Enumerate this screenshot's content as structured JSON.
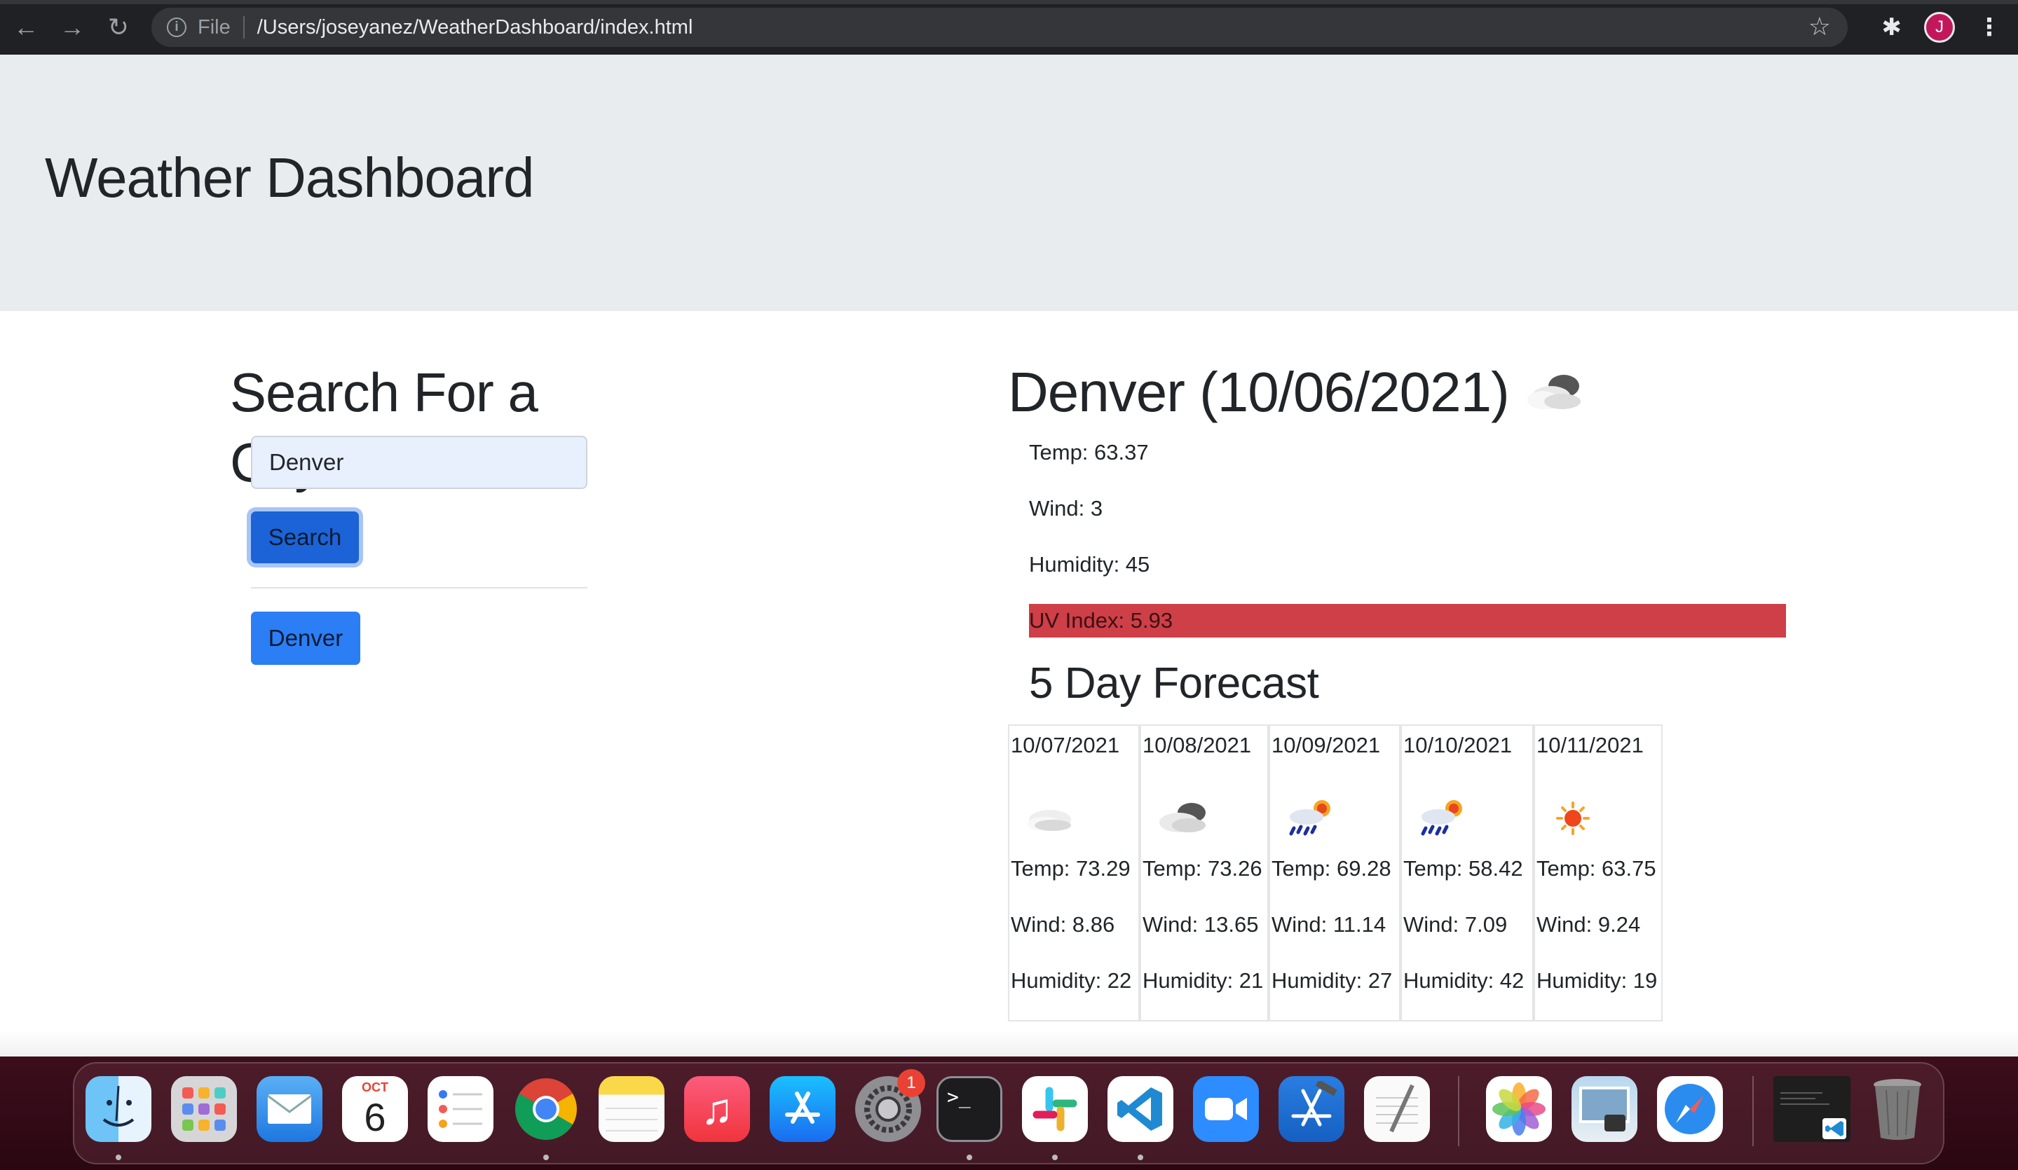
{
  "browser": {
    "scheme_label": "File",
    "url": "/Users/joseyanez/WeatherDashboard/index.html",
    "profile_initial": "J"
  },
  "header": {
    "title": "Weather Dashboard"
  },
  "search": {
    "heading": "Search For a City",
    "input_value": "Denver",
    "button_label": "Search",
    "history": [
      "Denver"
    ]
  },
  "current": {
    "title": "Denver (10/06/2021)",
    "icon": "partly-cloudy-icon",
    "temp": "Temp: 63.37",
    "wind": "Wind: 3",
    "humidity": "Humidity: 45",
    "uv": "UV Index: 5.93",
    "uv_color": "#ce3f47"
  },
  "forecast": {
    "title": "5 Day Forecast",
    "days": [
      {
        "date": "10/07/2021",
        "icon": "cloud-icon",
        "temp": "Temp: 73.29",
        "wind": "Wind: 8.86",
        "humidity": "Humidity: 22"
      },
      {
        "date": "10/08/2021",
        "icon": "broken-clouds-icon",
        "temp": "Temp: 73.26",
        "wind": "Wind: 13.65",
        "humidity": "Humidity: 21"
      },
      {
        "date": "10/09/2021",
        "icon": "sun-rain-icon",
        "temp": "Temp: 69.28",
        "wind": "Wind: 11.14",
        "humidity": "Humidity: 27"
      },
      {
        "date": "10/10/2021",
        "icon": "sun-rain-icon",
        "temp": "Temp: 58.42",
        "wind": "Wind: 7.09",
        "humidity": "Humidity: 42"
      },
      {
        "date": "10/11/2021",
        "icon": "sun-icon",
        "temp": "Temp: 63.75",
        "wind": "Wind: 9.24",
        "humidity": "Humidity: 19"
      }
    ]
  },
  "dock": {
    "calendar_month": "OCT",
    "calendar_day": "6",
    "settings_badge": "1",
    "apps": [
      "finder-icon",
      "launchpad-icon",
      "mail-icon",
      "calendar-icon",
      "reminders-icon",
      "chrome-icon",
      "notes-icon",
      "music-icon",
      "app-store-icon",
      "system-preferences-icon",
      "terminal-icon",
      "slack-icon",
      "vscode-icon",
      "zoom-icon",
      "xcode-icon",
      "textedit-icon",
      "photos-icon",
      "preview-icon",
      "safari-icon",
      "window-thumbnail-icon",
      "trash-icon"
    ]
  }
}
